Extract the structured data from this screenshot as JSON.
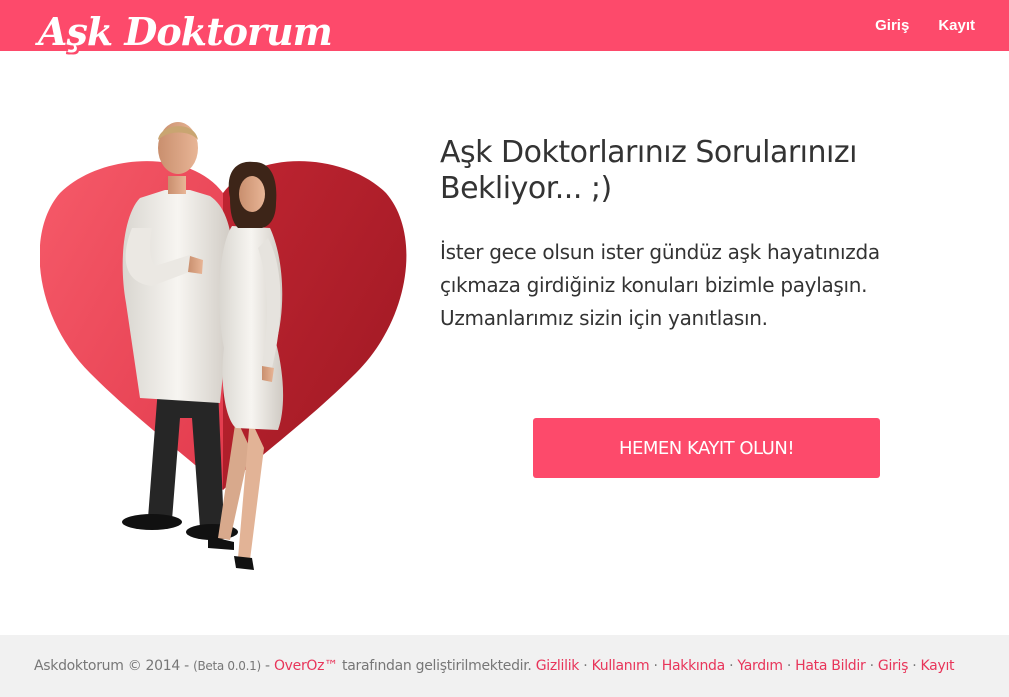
{
  "header": {
    "logo_text": "Aşk Doktorum",
    "nav": [
      {
        "label": "Giriş"
      },
      {
        "label": "Kayıt"
      }
    ]
  },
  "hero": {
    "headline": "Aşk Doktorlarınız Sorularınızı Bekliyor... ;)",
    "description": "İster gece olsun ister gündüz aşk hayatınızda çıkmaza girdiğiniz konuları bizimle paylaşın. Uzmanlarımız sizin için yanıtlasın.",
    "cta_label": "HEMEN KAYIT OLUN!"
  },
  "footer": {
    "copyright": "Askdoktorum © 2014 -",
    "version": "(Beta 0.0.1)",
    "dash": "-",
    "developer_link": "OverOz™",
    "developer_text": "tarafından geliştirilmektedir.",
    "links": [
      {
        "label": "Gizlilik"
      },
      {
        "label": "Kullanım"
      },
      {
        "label": "Hakkında"
      },
      {
        "label": "Yardım"
      },
      {
        "label": "Hata Bildir"
      },
      {
        "label": "Giriş"
      },
      {
        "label": "Kayıt"
      }
    ],
    "separator": "·"
  },
  "colors": {
    "brand": "#fd4a6b",
    "heart_light": "#f0495a",
    "heart_dark": "#b3222f",
    "footer_bg": "#f1f1f1",
    "link": "#e8355a"
  },
  "icons": {
    "hero_art": "heart-doctors-illustration"
  }
}
